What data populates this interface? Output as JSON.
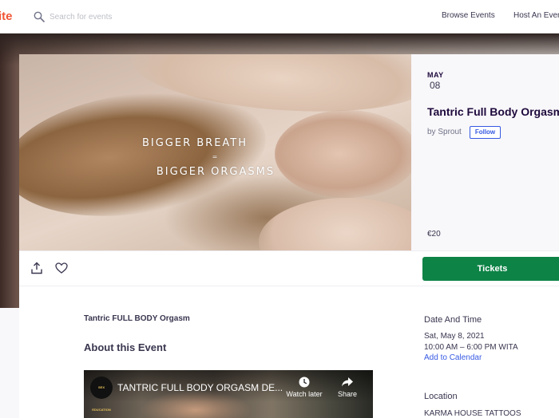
{
  "nav": {
    "logo": "ite",
    "search_placeholder": "Search for events",
    "browse_events": "Browse Events",
    "host_event": "Host An Even"
  },
  "hero": {
    "line1": "BIGGER BREATH",
    "separator": "=",
    "line2": "BIGGER ORGASMS"
  },
  "event": {
    "month": "MAY",
    "day": "08",
    "title": "Tantric Full Body Orgasm",
    "organizer_prefix": "by Sprout",
    "follow_label": "Follow",
    "price": "€20"
  },
  "actions": {
    "tickets_label": "Tickets"
  },
  "body": {
    "summary": "Tantric FULL BODY Orgasm",
    "about_heading": "About this Event"
  },
  "video": {
    "channel_badge": "SEX EDUCATION",
    "title": "TANTRIC FULL BODY ORGASM DE...",
    "watch_later": "Watch later",
    "share": "Share"
  },
  "sidebar": {
    "date_time_heading": "Date And Time",
    "date": "Sat, May 8, 2021",
    "time": "10:00 AM – 6:00 PM WITA",
    "add_calendar": "Add to Calendar",
    "location_heading": "Location",
    "location_name": "KARMA HOUSE TATTOOS"
  },
  "colors": {
    "brand": "#f05537",
    "tickets": "#0d8346",
    "link": "#3659e3"
  }
}
